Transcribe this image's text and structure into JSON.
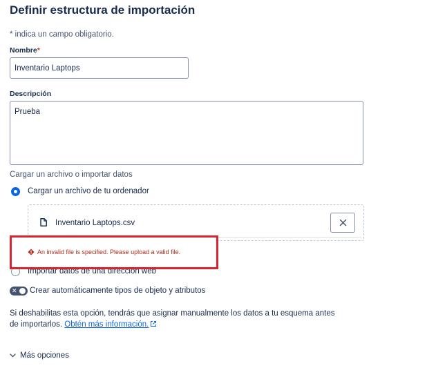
{
  "page": {
    "title": "Definir estructura de importación",
    "required_note": "* indica un campo obligatorio."
  },
  "name_field": {
    "label": "Nombre",
    "required_marker": "*",
    "value": "Inventario Laptops"
  },
  "description_field": {
    "label": "Descripción",
    "value": "Prueba"
  },
  "import_source": {
    "label": "Cargar un archivo o importar datos",
    "options": [
      {
        "label": "Cargar un archivo de tu ordenador",
        "selected": true
      },
      {
        "label": "Importar datos de una dirección web",
        "selected": false
      }
    ]
  },
  "uploaded_file": {
    "name": "Inventario Laptops.csv",
    "file_icon": "file-icon",
    "remove_icon": "close-icon"
  },
  "error": {
    "message": "An invalid file is specified. Please upload a valid file.",
    "icon": "warning-icon",
    "color": "#ae2a19",
    "highlight_color": "#d9232d"
  },
  "auto_create": {
    "label": "Crear automáticamente tipos de objeto y atributos",
    "enabled": false
  },
  "help": {
    "text": "Si deshabilitas esta opción, tendrás que asignar manualmente los datos a tu esquema antes de importarlos.",
    "link_text": "Obtén más información.",
    "link_icon": "external-link-icon"
  },
  "more_options": {
    "label": "Más opciones",
    "icon": "chevron-down-icon"
  },
  "colors": {
    "accent": "#0c66e4",
    "text": "#172b4d",
    "subtle_text": "#44546f",
    "border": "#8590a2"
  }
}
